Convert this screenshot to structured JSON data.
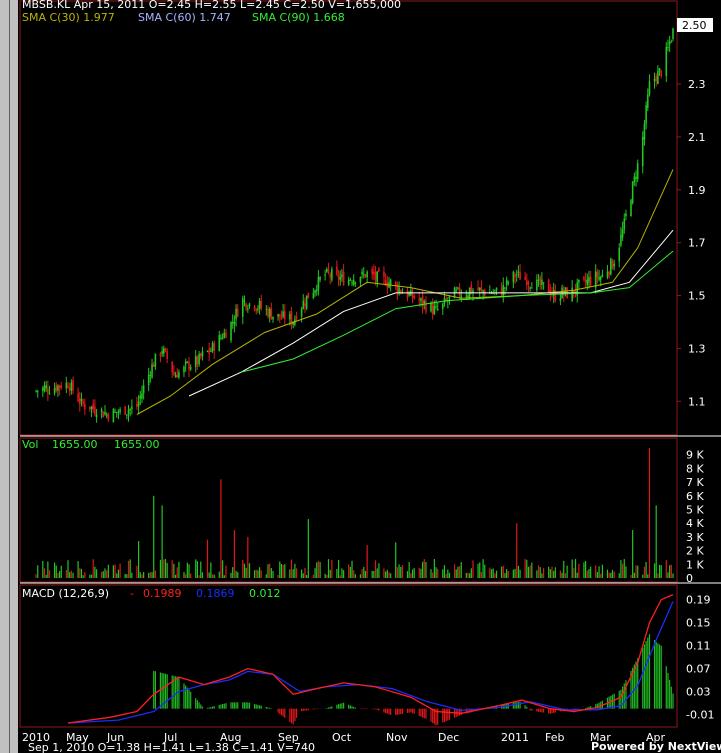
{
  "header": {
    "line1": "MBSB.KL Apr 15, 2011   O=2.45   H=2.55   L=2.45   C=2.50   V=1,655,000",
    "sma30": "SMA C(30) 1.977",
    "sma60": "SMA C(60) 1.747",
    "sma90": "SMA C(90) 1.668",
    "last_price": "2.50"
  },
  "volume_header": {
    "label": "Vol",
    "v1": "1655.00",
    "v2": "1655.00"
  },
  "macd_header": {
    "label": "MACD (12,26,9)",
    "dash": "-",
    "macd": "0.1989",
    "signal": "0.1869",
    "hist": "0.012"
  },
  "footer": {
    "status": "Sep 1, 2010   O=1.38   H=1.41   L=1.38   C=1.41   V=740",
    "brand": "Powered by NextView"
  },
  "colors": {
    "up": "#22c522",
    "down": "#e01818",
    "sma30": "#b8b400",
    "sma60": "#ffffff",
    "sma90": "#33ee33",
    "macd": "#ff2020",
    "signal": "#1a2cff",
    "hist_pos": "#22b822",
    "hist_neg": "#e01818",
    "axis": "#ffffff",
    "frame": "#8b1a1a"
  },
  "chart_data": [
    {
      "type": "candlestick",
      "title": "MBSB.KL",
      "x_labels": [
        "2010",
        "May",
        "Jun",
        "Jul",
        "Aug",
        "Sep",
        "Oct",
        "Nov",
        "Dec",
        "2011",
        "Feb",
        "Mar",
        "Apr"
      ],
      "y_ticks": [
        1.1,
        1.3,
        1.5,
        1.7,
        1.9,
        2.1,
        2.3
      ],
      "ylim": [
        0.98,
        2.58
      ],
      "last": 2.5,
      "close_path": [
        [
          "2010-04-01",
          1.14
        ],
        [
          "2010-04-20",
          1.17
        ],
        [
          "2010-04-28",
          1.09
        ],
        [
          "2010-05-15",
          1.05
        ],
        [
          "2010-05-31",
          1.08
        ],
        [
          "2010-06-08",
          1.22
        ],
        [
          "2010-06-15",
          1.3
        ],
        [
          "2010-06-22",
          1.2
        ],
        [
          "2010-07-05",
          1.25
        ],
        [
          "2010-07-15",
          1.3
        ],
        [
          "2010-07-25",
          1.38
        ],
        [
          "2010-08-02",
          1.48
        ],
        [
          "2010-08-12",
          1.46
        ],
        [
          "2010-08-22",
          1.42
        ],
        [
          "2010-09-01",
          1.41
        ],
        [
          "2010-09-10",
          1.5
        ],
        [
          "2010-09-20",
          1.58
        ],
        [
          "2010-10-01",
          1.56
        ],
        [
          "2010-10-15",
          1.58
        ],
        [
          "2010-10-25",
          1.56
        ],
        [
          "2010-11-05",
          1.52
        ],
        [
          "2010-11-15",
          1.48
        ],
        [
          "2010-11-25",
          1.44
        ],
        [
          "2010-12-05",
          1.5
        ],
        [
          "2010-12-15",
          1.52
        ],
        [
          "2011-01-01",
          1.51
        ],
        [
          "2011-01-12",
          1.58
        ],
        [
          "2011-01-25",
          1.54
        ],
        [
          "2011-02-05",
          1.5
        ],
        [
          "2011-02-15",
          1.52
        ],
        [
          "2011-02-25",
          1.56
        ],
        [
          "2011-03-05",
          1.58
        ],
        [
          "2011-03-12",
          1.64
        ],
        [
          "2011-03-20",
          1.85
        ],
        [
          "2011-03-27",
          2.05
        ],
        [
          "2011-04-01",
          2.3
        ],
        [
          "2011-04-08",
          2.35
        ],
        [
          "2011-04-15",
          2.5
        ]
      ],
      "sma30_path": [
        [
          "2010-05-31",
          1.05
        ],
        [
          "2010-06-20",
          1.12
        ],
        [
          "2010-07-15",
          1.24
        ],
        [
          "2010-08-15",
          1.36
        ],
        [
          "2010-09-15",
          1.43
        ],
        [
          "2010-10-15",
          1.55
        ],
        [
          "2010-11-10",
          1.53
        ],
        [
          "2010-12-10",
          1.49
        ],
        [
          "2011-01-15",
          1.5
        ],
        [
          "2011-02-15",
          1.52
        ],
        [
          "2011-03-10",
          1.55
        ],
        [
          "2011-03-25",
          1.68
        ],
        [
          "2011-04-15",
          1.977
        ]
      ],
      "sma60_path": [
        [
          "2010-07-01",
          1.12
        ],
        [
          "2010-08-01",
          1.21
        ],
        [
          "2010-09-01",
          1.32
        ],
        [
          "2010-10-01",
          1.44
        ],
        [
          "2010-11-01",
          1.51
        ],
        [
          "2010-12-01",
          1.51
        ],
        [
          "2011-01-15",
          1.51
        ],
        [
          "2011-02-25",
          1.51
        ],
        [
          "2011-03-20",
          1.55
        ],
        [
          "2011-04-15",
          1.747
        ]
      ],
      "sma90_path": [
        [
          "2010-08-01",
          1.21
        ],
        [
          "2010-09-01",
          1.26
        ],
        [
          "2010-10-01",
          1.35
        ],
        [
          "2010-11-01",
          1.45
        ],
        [
          "2010-12-01",
          1.48
        ],
        [
          "2011-01-15",
          1.5
        ],
        [
          "2011-02-25",
          1.51
        ],
        [
          "2011-03-20",
          1.53
        ],
        [
          "2011-04-15",
          1.668
        ]
      ]
    },
    {
      "type": "bar",
      "title": "Vol",
      "y_ticks": [
        0,
        1000,
        2000,
        3000,
        4000,
        5000,
        6000,
        7000,
        8000,
        9000
      ],
      "y_tick_labels": [
        "0",
        "1 K",
        "2 K",
        "3 K",
        "4 K",
        "5 K",
        "6 K",
        "7 K",
        "8 K",
        "9 K"
      ],
      "ylim": [
        0,
        10000
      ],
      "spikes": [
        [
          "2010-06-01",
          2700
        ],
        [
          "2010-06-10",
          6000
        ],
        [
          "2010-06-15",
          5300
        ],
        [
          "2010-06-20",
          3300
        ],
        [
          "2010-07-12",
          2800
        ],
        [
          "2010-07-20",
          7200
        ],
        [
          "2010-07-28",
          3500
        ],
        [
          "2010-08-05",
          3000
        ],
        [
          "2010-09-10",
          4300
        ],
        [
          "2010-09-25",
          2600
        ],
        [
          "2010-10-15",
          2400
        ],
        [
          "2010-11-01",
          2600
        ],
        [
          "2010-11-20",
          2500
        ],
        [
          "2011-01-12",
          4000
        ],
        [
          "2011-02-20",
          3300
        ],
        [
          "2011-03-05",
          2600
        ],
        [
          "2011-03-22",
          3500
        ],
        [
          "2011-03-27",
          4400
        ],
        [
          "2011-04-01",
          9500
        ],
        [
          "2011-04-05",
          5300
        ],
        [
          "2011-04-10",
          3300
        ]
      ]
    },
    {
      "type": "line",
      "title": "MACD (12,26,9)",
      "y_ticks": [
        -0.01,
        0.03,
        0.07,
        0.11,
        0.15,
        0.19
      ],
      "ylim": [
        -0.025,
        0.2
      ],
      "series": [
        {
          "name": "MACD",
          "points": [
            [
              "2010-04-20",
              -0.025
            ],
            [
              "2010-05-15",
              -0.015
            ],
            [
              "2010-05-31",
              -0.005
            ],
            [
              "2010-06-10",
              0.025
            ],
            [
              "2010-06-25",
              0.055
            ],
            [
              "2010-07-10",
              0.042
            ],
            [
              "2010-07-25",
              0.055
            ],
            [
              "2010-08-05",
              0.07
            ],
            [
              "2010-08-20",
              0.06
            ],
            [
              "2010-09-01",
              0.025
            ],
            [
              "2010-09-15",
              0.035
            ],
            [
              "2010-10-01",
              0.045
            ],
            [
              "2010-10-20",
              0.038
            ],
            [
              "2010-11-10",
              0.02
            ],
            [
              "2010-11-25",
              -0.005
            ],
            [
              "2010-12-10",
              -0.008
            ],
            [
              "2011-01-01",
              0.005
            ],
            [
              "2011-01-15",
              0.015
            ],
            [
              "2011-02-01",
              0.0
            ],
            [
              "2011-02-15",
              -0.005
            ],
            [
              "2011-03-01",
              0.002
            ],
            [
              "2011-03-15",
              0.02
            ],
            [
              "2011-03-25",
              0.08
            ],
            [
              "2011-04-01",
              0.15
            ],
            [
              "2011-04-08",
              0.19
            ],
            [
              "2011-04-15",
              0.1989
            ]
          ]
        },
        {
          "name": "Signal",
          "points": [
            [
              "2010-04-20",
              -0.025
            ],
            [
              "2010-05-20",
              -0.02
            ],
            [
              "2010-06-10",
              -0.005
            ],
            [
              "2010-06-25",
              0.03
            ],
            [
              "2010-07-10",
              0.042
            ],
            [
              "2010-07-25",
              0.05
            ],
            [
              "2010-08-05",
              0.065
            ],
            [
              "2010-08-20",
              0.06
            ],
            [
              "2010-09-05",
              0.03
            ],
            [
              "2010-09-20",
              0.038
            ],
            [
              "2010-10-10",
              0.042
            ],
            [
              "2010-10-30",
              0.035
            ],
            [
              "2010-11-20",
              0.012
            ],
            [
              "2010-12-10",
              -0.003
            ],
            [
              "2011-01-01",
              0.002
            ],
            [
              "2011-01-20",
              0.012
            ],
            [
              "2011-02-10",
              -0.002
            ],
            [
              "2011-03-01",
              -0.002
            ],
            [
              "2011-03-15",
              0.005
            ],
            [
              "2011-03-25",
              0.04
            ],
            [
              "2011-04-05",
              0.12
            ],
            [
              "2011-04-15",
              0.1869
            ]
          ]
        }
      ]
    }
  ]
}
